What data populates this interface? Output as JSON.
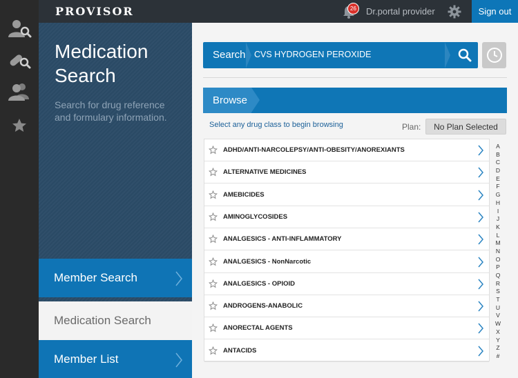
{
  "app": {
    "brand": "PROVISOR"
  },
  "rail": {
    "icons": [
      "member-search-icon",
      "medication-search-icon",
      "member-list-icon",
      "favorites-star-icon"
    ]
  },
  "topbar": {
    "notifications_count": "26",
    "provider_name": "Dr.portal provider",
    "sign_out_label": "Sign out"
  },
  "left_panel": {
    "title_line1": "Medication",
    "title_line2": "Search",
    "subtitle": "Search for drug reference and formulary information."
  },
  "nav": {
    "member_search": "Member Search",
    "medication_search": "Medication Search",
    "member_list": "Member List"
  },
  "search": {
    "label": "Search",
    "value": "CVS HYDROGEN PEROXIDE"
  },
  "browse": {
    "tab_label": "Browse",
    "hint": "Select any drug class to begin browsing",
    "plan_label": "Plan:",
    "plan_value": "No Plan Selected"
  },
  "drug_classes": [
    "ADHD/ANTI-NARCOLEPSY/ANTI-OBESITY/ANOREXIANTS",
    "ALTERNATIVE MEDICINES",
    "AMEBICIDES",
    "AMINOGLYCOSIDES",
    "ANALGESICS - ANTI-INFLAMMATORY",
    "ANALGESICS - NonNarcotic",
    "ANALGESICS - OPIOID",
    "ANDROGENS-ANABOLIC",
    "ANORECTAL AGENTS",
    "ANTACIDS"
  ],
  "alpha_index": [
    "A",
    "B",
    "C",
    "D",
    "E",
    "F",
    "G",
    "H",
    "I",
    "J",
    "K",
    "L",
    "M",
    "N",
    "O",
    "P",
    "Q",
    "R",
    "S",
    "T",
    "U",
    "V",
    "W",
    "X",
    "Y",
    "Z",
    "#"
  ],
  "colors": {
    "accent_blue": "#0f76b6",
    "panel_navy": "#2b4b67",
    "topbar_dark": "#2c3238",
    "badge_red": "#d9312b"
  }
}
